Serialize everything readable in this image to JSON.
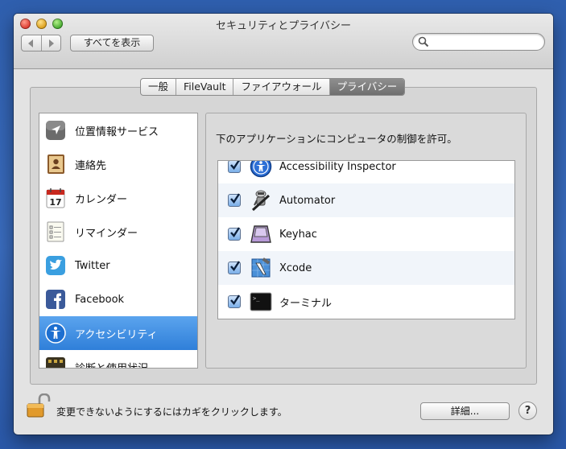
{
  "window": {
    "title": "セキュリティとプライバシー"
  },
  "toolbar": {
    "back_icon": "chevron-left-icon",
    "forward_icon": "chevron-right-icon",
    "show_all_label": "すべてを表示",
    "search_value": "",
    "search_placeholder": ""
  },
  "tabs": [
    {
      "label": "一般",
      "active": false
    },
    {
      "label": "FileVault",
      "active": false
    },
    {
      "label": "ファイアウォール",
      "active": false
    },
    {
      "label": "プライバシー",
      "active": true
    }
  ],
  "sidebar": {
    "items": [
      {
        "label": "位置情報サービス",
        "icon": "location-arrow-icon",
        "selected": false
      },
      {
        "label": "連絡先",
        "icon": "contacts-book-icon",
        "selected": false
      },
      {
        "label": "カレンダー",
        "icon": "calendar-icon",
        "selected": false,
        "icon_text": "17"
      },
      {
        "label": "リマインダー",
        "icon": "reminders-list-icon",
        "selected": false
      },
      {
        "label": "Twitter",
        "icon": "twitter-bird-icon",
        "selected": false
      },
      {
        "label": "Facebook",
        "icon": "facebook-icon",
        "selected": false
      },
      {
        "label": "アクセシビリティ",
        "icon": "accessibility-icon",
        "selected": true
      },
      {
        "label": "診断と使用状況",
        "icon": "diagnostics-icon",
        "selected": false
      }
    ]
  },
  "main": {
    "prompt": "下のアプリケーションにコンピュータの制御を許可。",
    "apps": [
      {
        "name": "Accessibility Inspector",
        "checked": true,
        "icon": "accessibility-inspector-icon"
      },
      {
        "name": "Automator",
        "checked": true,
        "icon": "automator-robot-icon"
      },
      {
        "name": "Keyhac",
        "checked": true,
        "icon": "keyhac-key-icon"
      },
      {
        "name": "Xcode",
        "checked": true,
        "icon": "xcode-hammer-icon"
      },
      {
        "name": "ターミナル",
        "checked": true,
        "icon": "terminal-icon",
        "icon_text": ">_"
      }
    ]
  },
  "footer": {
    "lock_text": "変更できないようにするにはカギをクリックします。",
    "lock_icon": "unlocked-padlock-icon",
    "detail_label": "詳細...",
    "help_label": "?"
  },
  "colors": {
    "selection": "#2f7fd9",
    "desktop": "#3a6cbe",
    "window_bg": "#e3e3e3"
  }
}
